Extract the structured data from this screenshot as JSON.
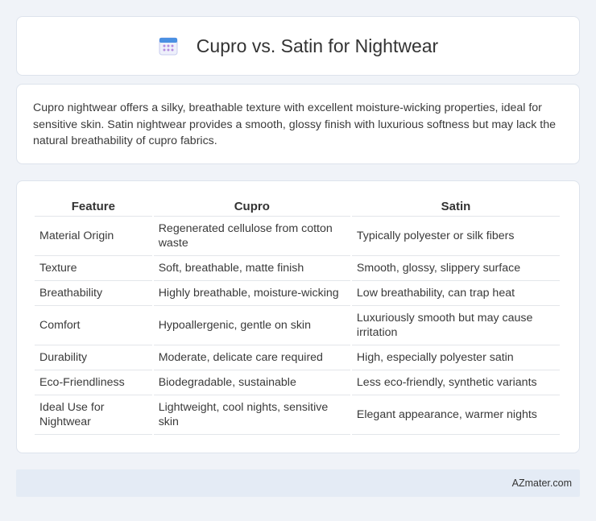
{
  "header": {
    "title": "Cupro vs. Satin for Nightwear",
    "icon": "calendar-icon"
  },
  "intro": {
    "text": "Cupro nightwear offers a silky, breathable texture with excellent moisture-wicking properties, ideal for sensitive skin. Satin nightwear provides a smooth, glossy finish with luxurious softness but may lack the natural breathability of cupro fabrics."
  },
  "table": {
    "headers": [
      "Feature",
      "Cupro",
      "Satin"
    ],
    "rows": [
      [
        "Material Origin",
        "Regenerated cellulose from cotton waste",
        "Typically polyester or silk fibers"
      ],
      [
        "Texture",
        "Soft, breathable, matte finish",
        "Smooth, glossy, slippery surface"
      ],
      [
        "Breathability",
        "Highly breathable, moisture-wicking",
        "Low breathability, can trap heat"
      ],
      [
        "Comfort",
        "Hypoallergenic, gentle on skin",
        "Luxuriously smooth but may cause irritation"
      ],
      [
        "Durability",
        "Moderate, delicate care required",
        "High, especially polyester satin"
      ],
      [
        "Eco-Friendliness",
        "Biodegradable, sustainable",
        "Less eco-friendly, synthetic variants"
      ],
      [
        "Ideal Use for Nightwear",
        "Lightweight, cool nights, sensitive skin",
        "Elegant appearance, warmer nights"
      ]
    ]
  },
  "footer": {
    "text": "AZmater.com"
  },
  "colors": {
    "background": "#f0f3f8",
    "footer_bg": "#e4ebf5",
    "icon_blue": "#4a90e2",
    "icon_purple": "#b48ce0"
  }
}
